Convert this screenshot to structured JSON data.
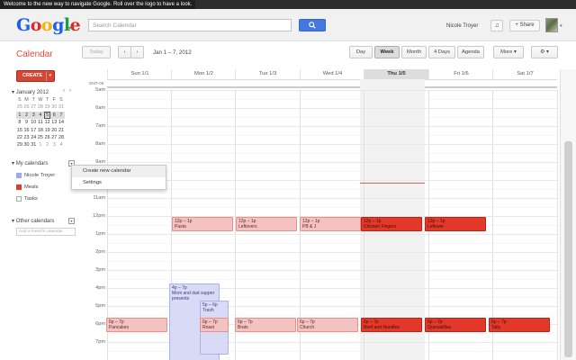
{
  "tooltip": "Welcome to the new way to navigate Google. Roll over the logo to have a look.",
  "header": {
    "logo": "Google",
    "search_placeholder": "Search Calendar",
    "user_name": "Nicole Troyer",
    "share_label": "+ Share",
    "bell_glyph": "♫"
  },
  "toolbar": {
    "app_title": "Calendar",
    "today_label": "Today",
    "prev_glyph": "‹",
    "next_glyph": "›",
    "date_range": "Jan 1 – 7, 2012",
    "views": [
      "Day",
      "Week",
      "Month",
      "4 Days",
      "Agenda"
    ],
    "active_view": "Week",
    "more_label": "More ▾",
    "settings_glyph": "⚙ ▾"
  },
  "sidebar": {
    "create_label": "CREATE",
    "create_caret": "▾",
    "mini_cal": {
      "title": "January 2012",
      "collapse_glyph": "▾",
      "prev_glyph": "‹",
      "next_glyph": "›",
      "weekdays": [
        "S",
        "M",
        "T",
        "W",
        "T",
        "F",
        "S"
      ],
      "weeks": [
        [
          "25",
          "26",
          "27",
          "28",
          "29",
          "30",
          "31"
        ],
        [
          "1",
          "2",
          "3",
          "4",
          "5",
          "6",
          "7"
        ],
        [
          "8",
          "9",
          "10",
          "11",
          "12",
          "13",
          "14"
        ],
        [
          "15",
          "16",
          "17",
          "18",
          "19",
          "20",
          "21"
        ],
        [
          "22",
          "23",
          "24",
          "25",
          "26",
          "27",
          "28"
        ],
        [
          "29",
          "30",
          "31",
          "1",
          "2",
          "3",
          "4"
        ]
      ]
    },
    "my_calendars_title": "My calendars",
    "my_calendars": [
      {
        "name": "Nicole Troyer",
        "color": "#a2a8f0"
      },
      {
        "name": "Meals",
        "color": "#dd3b2b"
      },
      {
        "name": "Tasks",
        "color": "#ffffff"
      }
    ],
    "other_calendars_title": "Other calendars",
    "add_friend_placeholder": "Add a friend's calendar",
    "dropdown": [
      "Create new calendar",
      "Settings"
    ]
  },
  "grid": {
    "timezone": "GMT-06",
    "days": [
      "Sun 1/1",
      "Mon 1/2",
      "Tue 1/3",
      "Wed 1/4",
      "Thu 1/5",
      "Fri 1/6",
      "Sat 1/7"
    ],
    "today_index": 4,
    "hours": [
      "5am",
      "6am",
      "7am",
      "8am",
      "9am",
      "10am",
      "11am",
      "12pm",
      "1pm",
      "2pm",
      "3pm",
      "4pm",
      "5pm",
      "6pm",
      "7pm"
    ]
  },
  "events": [
    {
      "time": "12p – 1p",
      "title": "Pasta",
      "type": "meal"
    },
    {
      "time": "12p – 1p",
      "title": "Leftovers",
      "type": "meal"
    },
    {
      "time": "12p – 1p",
      "title": "PB & J",
      "type": "meal"
    },
    {
      "time": "12p – 1p",
      "title": "Chicken Fingers",
      "type": "meal-dark"
    },
    {
      "time": "12p – 1p",
      "title": "Leftover",
      "type": "meal-dark"
    },
    {
      "time": "4p – 7p",
      "title": "Mom and dad supper presents",
      "type": "personal"
    },
    {
      "time": "5p – 6p",
      "title": "Trash",
      "type": "personal"
    },
    {
      "time": "6p – 7p",
      "title": "Pancakes",
      "type": "meal"
    },
    {
      "time": "6p – 7p",
      "title": "Roast",
      "type": "meal"
    },
    {
      "time": "6p – 7p",
      "title": "Brats",
      "type": "meal"
    },
    {
      "time": "6p – 7p",
      "title": "Church",
      "type": "meal"
    },
    {
      "time": "6p – 7p",
      "title": "Beef and Noodles",
      "type": "meal-dark"
    },
    {
      "time": "6p – 7p",
      "title": "Quesadillas",
      "type": "meal-dark"
    },
    {
      "time": "6p – 7p",
      "title": "Tally",
      "type": "meal-dark"
    }
  ]
}
